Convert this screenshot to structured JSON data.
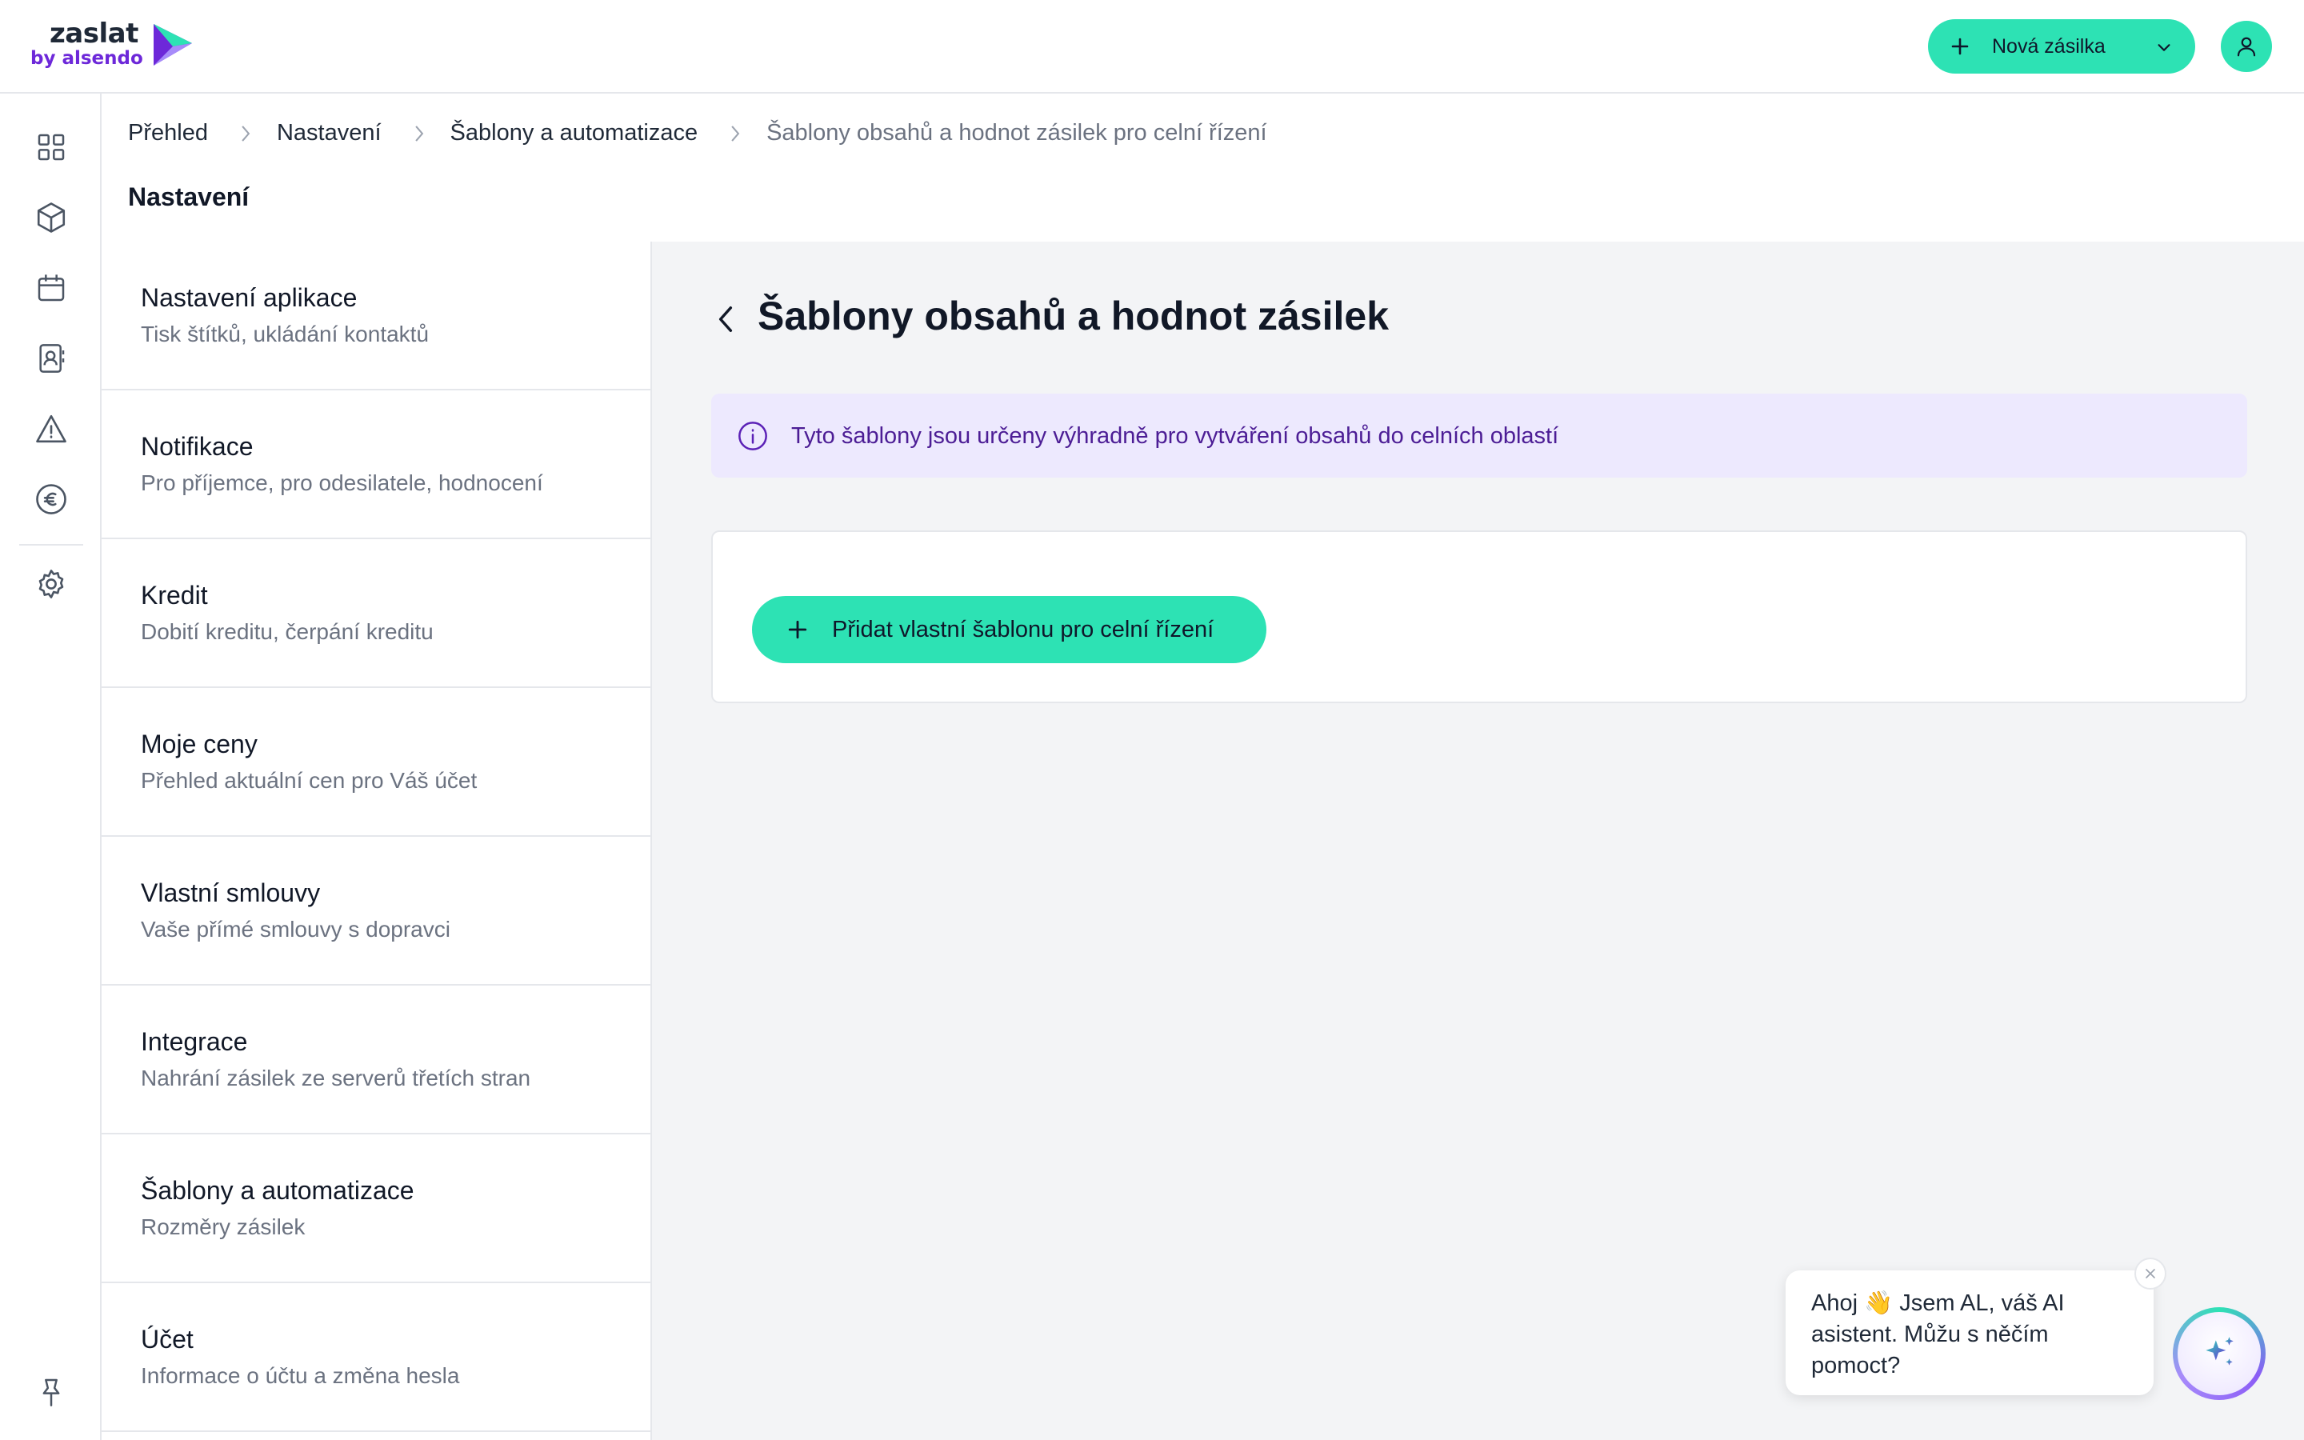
{
  "brand": {
    "name": "zaslat",
    "sub": "by alsendo",
    "colors": {
      "accent": "#2de2b4",
      "brand_purple": "#6d28d9",
      "info_bg": "#ede9fe",
      "info_text": "#4c1d95"
    }
  },
  "header": {
    "new_shipment_label": "Nová zásilka",
    "icons": [
      "plus-icon",
      "chevron-down-icon",
      "user-icon"
    ]
  },
  "rail": {
    "icons": [
      "dashboard-icon",
      "package-icon",
      "calendar-icon",
      "contacts-icon",
      "warning-icon",
      "euro-icon",
      "settings-icon",
      "pin-icon"
    ]
  },
  "breadcrumb": [
    "Přehled",
    "Nastavení",
    "Šablony a automatizace",
    "Šablony obsahů a hodnot zásilek pro celní řízení"
  ],
  "section_title": "Nastavení",
  "menu": [
    {
      "title": "Nastavení aplikace",
      "subtitle": "Tisk štítků, ukládání kontaktů"
    },
    {
      "title": "Notifikace",
      "subtitle": "Pro příjemce, pro odesilatele, hodnocení"
    },
    {
      "title": "Kredit",
      "subtitle": "Dobití kreditu, čerpání kreditu"
    },
    {
      "title": "Moje ceny",
      "subtitle": "Přehled aktuální cen pro Váš účet"
    },
    {
      "title": "Vlastní smlouvy",
      "subtitle": "Vaše přímé smlouvy s dopravci"
    },
    {
      "title": "Integrace",
      "subtitle": "Nahrání zásilek ze serverů třetích stran"
    },
    {
      "title": "Šablony a automatizace",
      "subtitle": "Rozměry zásilek"
    },
    {
      "title": "Účet",
      "subtitle": "Informace o účtu a změna hesla"
    }
  ],
  "main": {
    "heading": "Šablony obsahů a hodnot zásilek",
    "info_text": "Tyto šablony jsou určeny výhradně pro vytváření obsahů do celních oblastí",
    "add_button_label": "Přidat vlastní šablonu pro celní řízení"
  },
  "chat": {
    "message": "Ahoj 👋 Jsem AL, váš AI asistent. Můžu s něčím pomoct?"
  }
}
